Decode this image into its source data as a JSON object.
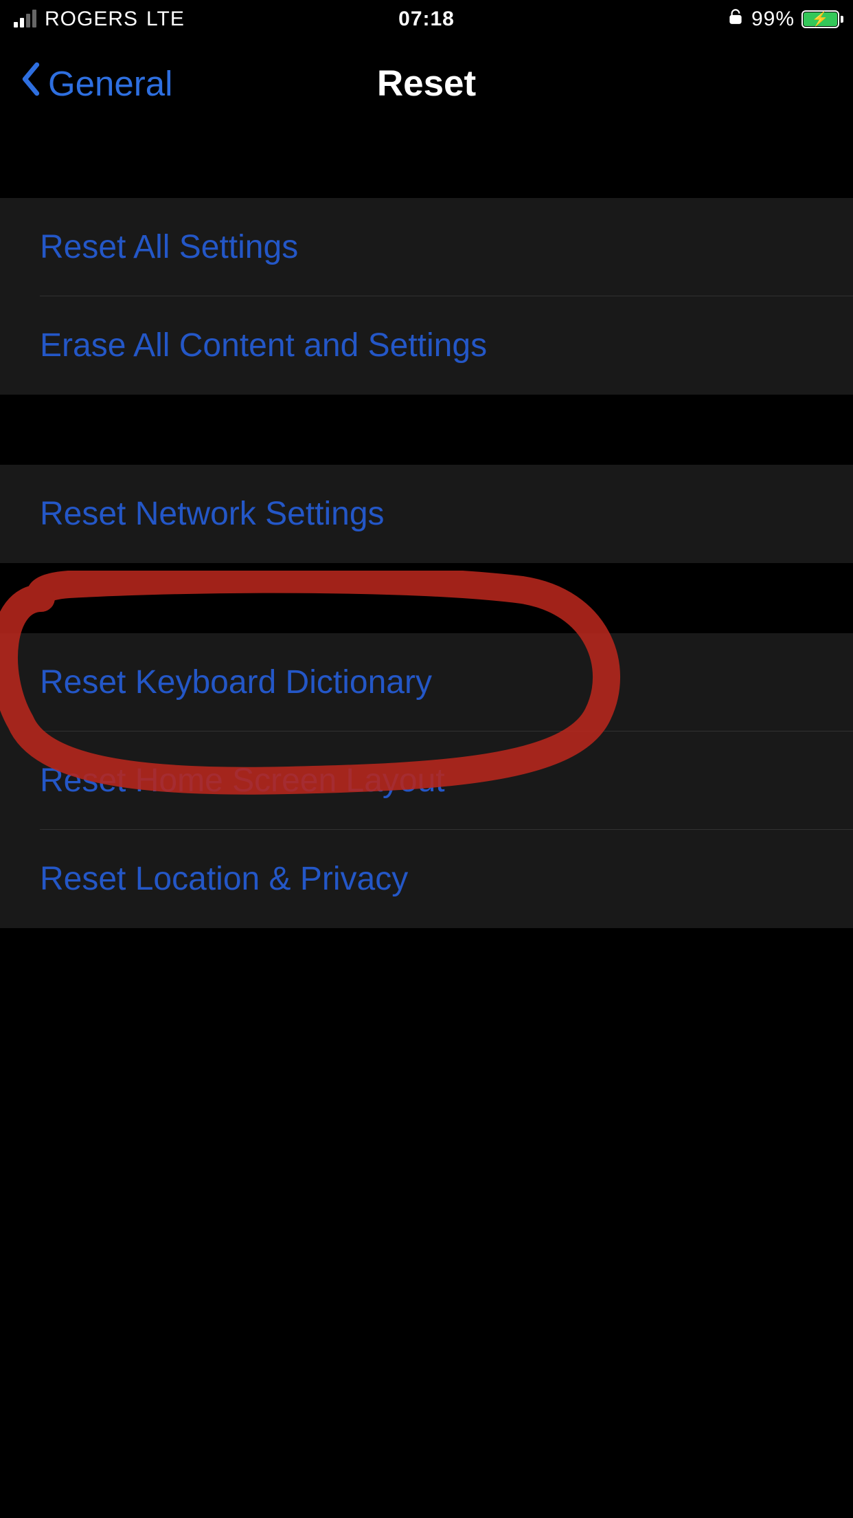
{
  "status_bar": {
    "signal_active_bars": 2,
    "carrier": "ROGERS",
    "network": "LTE",
    "time": "07:18",
    "battery_pct": "99%"
  },
  "nav": {
    "back_label": "General",
    "title": "Reset"
  },
  "groups": [
    {
      "items": [
        {
          "label": "Reset All Settings"
        },
        {
          "label": "Erase All Content and Settings"
        }
      ]
    },
    {
      "items": [
        {
          "label": "Reset Network Settings"
        }
      ]
    },
    {
      "items": [
        {
          "label": "Reset Keyboard Dictionary"
        },
        {
          "label": "Reset Home Screen Layout"
        },
        {
          "label": "Reset Location & Privacy"
        }
      ]
    }
  ]
}
